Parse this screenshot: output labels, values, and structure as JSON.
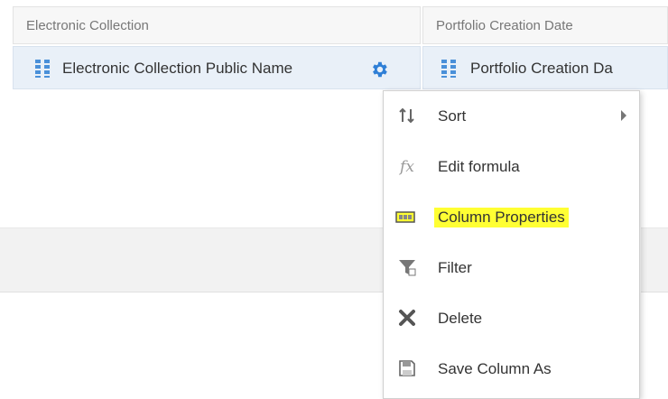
{
  "table": {
    "headers": [
      {
        "label": "Electronic Collection"
      },
      {
        "label": "Portfolio Creation Date"
      }
    ],
    "columns": [
      {
        "label": "Electronic Collection Public Name",
        "icon": "grip-icon"
      },
      {
        "label": "Portfolio Creation Da",
        "icon": "grip-icon"
      }
    ],
    "gear_icon": "gear-icon"
  },
  "context_menu": {
    "items": [
      {
        "label": "Sort",
        "icon": "sort-icon",
        "has_submenu": true
      },
      {
        "label": "Edit formula",
        "icon": "fx-icon"
      },
      {
        "label": "Column Properties",
        "icon": "column-properties-icon",
        "highlighted": true,
        "highlight_color": "#ffff33"
      },
      {
        "label": "Filter",
        "icon": "filter-icon"
      },
      {
        "label": "Delete",
        "icon": "delete-icon"
      },
      {
        "label": "Save Column As",
        "icon": "save-icon"
      }
    ]
  },
  "colors": {
    "accent": "#2f7fd6",
    "header_bg": "#f7f7f7",
    "column_bg": "#e9f0f8"
  }
}
